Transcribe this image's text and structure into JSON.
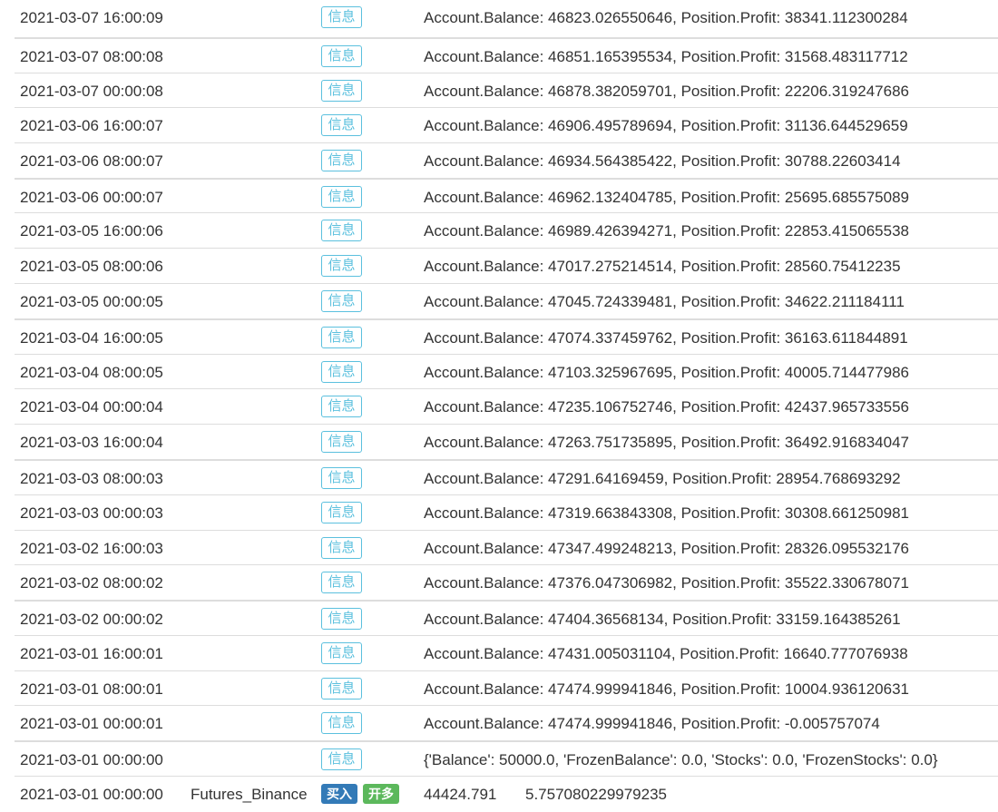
{
  "rows": [
    {
      "time": "2021-03-07 16:00:09",
      "tag": "信息",
      "message": "Account.Balance: 46823.026550646, Position.Profit: 38341.112300284"
    },
    {
      "time": "2021-03-07 08:00:08",
      "tag": "信息",
      "message": "Account.Balance: 46851.165395534, Position.Profit: 31568.483117712"
    },
    {
      "time": "2021-03-07 00:00:08",
      "tag": "信息",
      "message": "Account.Balance: 46878.382059701, Position.Profit: 22206.319247686"
    },
    {
      "time": "2021-03-06 16:00:07",
      "tag": "信息",
      "message": "Account.Balance: 46906.495789694, Position.Profit: 31136.644529659"
    },
    {
      "time": "2021-03-06 08:00:07",
      "tag": "信息",
      "message": "Account.Balance: 46934.564385422, Position.Profit: 30788.22603414"
    },
    {
      "time": "2021-03-06 00:00:07",
      "tag": "信息",
      "message": "Account.Balance: 46962.132404785, Position.Profit: 25695.685575089"
    },
    {
      "time": "2021-03-05 16:00:06",
      "tag": "信息",
      "message": "Account.Balance: 46989.426394271, Position.Profit: 22853.415065538"
    },
    {
      "time": "2021-03-05 08:00:06",
      "tag": "信息",
      "message": "Account.Balance: 47017.275214514, Position.Profit: 28560.75412235"
    },
    {
      "time": "2021-03-05 00:00:05",
      "tag": "信息",
      "message": "Account.Balance: 47045.724339481, Position.Profit: 34622.211184111"
    },
    {
      "time": "2021-03-04 16:00:05",
      "tag": "信息",
      "message": "Account.Balance: 47074.337459762, Position.Profit: 36163.611844891"
    },
    {
      "time": "2021-03-04 08:00:05",
      "tag": "信息",
      "message": "Account.Balance: 47103.325967695, Position.Profit: 40005.714477986"
    },
    {
      "time": "2021-03-04 00:00:04",
      "tag": "信息",
      "message": "Account.Balance: 47235.106752746, Position.Profit: 42437.965733556"
    },
    {
      "time": "2021-03-03 16:00:04",
      "tag": "信息",
      "message": "Account.Balance: 47263.751735895, Position.Profit: 36492.916834047"
    },
    {
      "time": "2021-03-03 08:00:03",
      "tag": "信息",
      "message": "Account.Balance: 47291.64169459, Position.Profit: 28954.768693292"
    },
    {
      "time": "2021-03-03 00:00:03",
      "tag": "信息",
      "message": "Account.Balance: 47319.663843308, Position.Profit: 30308.661250981"
    },
    {
      "time": "2021-03-02 16:00:03",
      "tag": "信息",
      "message": "Account.Balance: 47347.499248213, Position.Profit: 28326.095532176"
    },
    {
      "time": "2021-03-02 08:00:02",
      "tag": "信息",
      "message": "Account.Balance: 47376.047306982, Position.Profit: 35522.330678071"
    },
    {
      "time": "2021-03-02 00:00:02",
      "tag": "信息",
      "message": "Account.Balance: 47404.36568134, Position.Profit: 33159.164385261"
    },
    {
      "time": "2021-03-01 16:00:01",
      "tag": "信息",
      "message": "Account.Balance: 47431.005031104, Position.Profit: 16640.777076938"
    },
    {
      "time": "2021-03-01 08:00:01",
      "tag": "信息",
      "message": "Account.Balance: 47474.999941846, Position.Profit: 10004.936120631"
    },
    {
      "time": "2021-03-01 00:00:01",
      "tag": "信息",
      "message": "Account.Balance: 47474.999941846, Position.Profit: -0.005757074"
    },
    {
      "time": "2021-03-01 00:00:00",
      "tag": "信息",
      "message": "{'Balance': 50000.0, 'FrozenBalance': 0.0, 'Stocks': 0.0, 'FrozenStocks': 0.0}"
    }
  ],
  "order_row": {
    "time": "2021-03-01 00:00:00",
    "exchange": "Futures_Binance",
    "buy_label": "买入",
    "open_label": "开多",
    "price": "44424.791",
    "amount": "5.757080229979235"
  },
  "colors": {
    "info_badge": "#5bc0de",
    "buy_badge": "#337ab7",
    "open_badge": "#5cb85c",
    "divider": "#dddddd",
    "text": "#333333"
  }
}
